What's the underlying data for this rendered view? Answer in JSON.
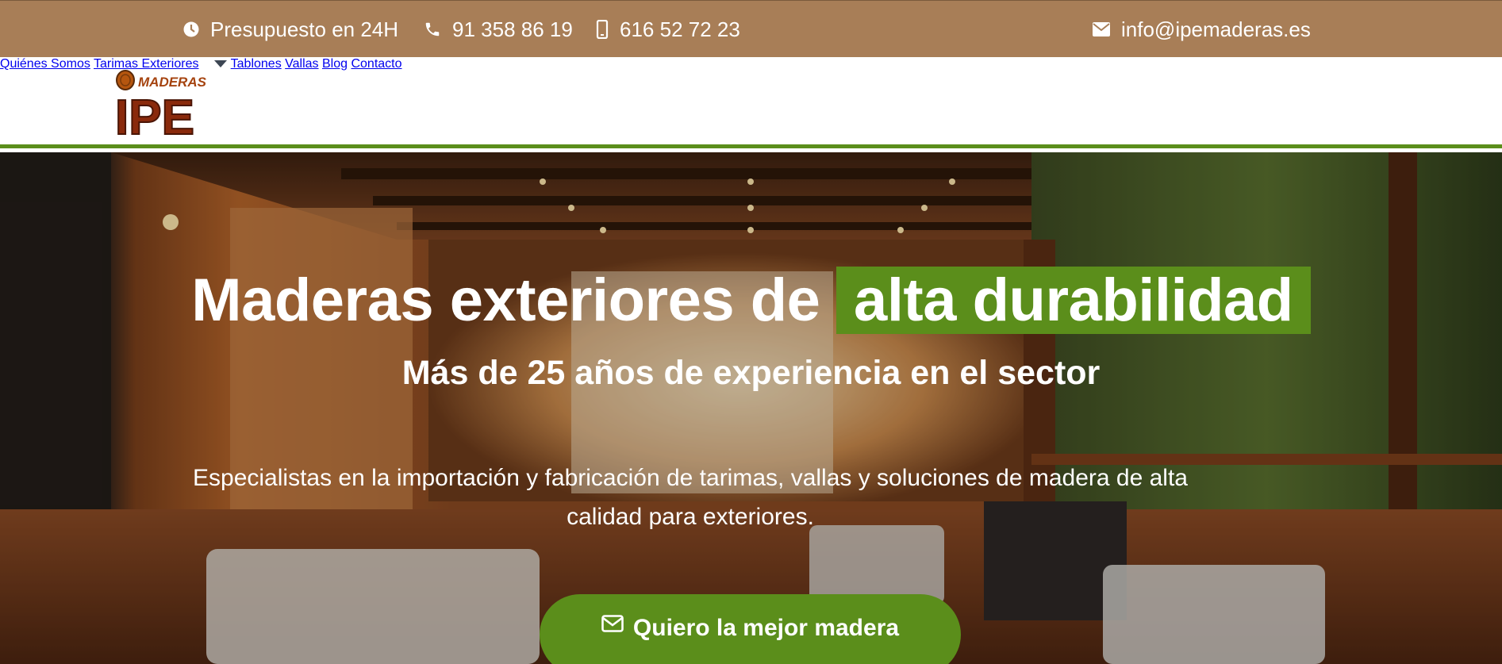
{
  "topbar": {
    "quote": "Presupuesto en 24H",
    "phone": "91 358 86 19",
    "mobile": "616 52 72 23",
    "email": "info@ipemaderas.es"
  },
  "logo": {
    "line1": "MADERAS",
    "line2": "IPE"
  },
  "nav": {
    "items": [
      "Quiénes Somos",
      "Tarimas Exteriores",
      "Tablones",
      "Vallas",
      "Blog",
      "Contacto"
    ]
  },
  "hero": {
    "title_prefix": "Maderas exteriores de",
    "title_highlight": "alta durabilidad",
    "subtitle": "Más de 25 años de experiencia en el sector",
    "description": "Especialistas en la importación y fabricación de tarimas, vallas y soluciones de madera de alta calidad para exteriores.",
    "cta": "Quiero la mejor madera"
  },
  "colors": {
    "topbar": "#a87e57",
    "accent_green": "#5b8e1b",
    "nav_text": "#3d4653"
  },
  "icons": [
    "clock-icon",
    "phone-icon",
    "mobile-icon",
    "envelope-icon",
    "chevron-down-icon",
    "envelope-outline-icon"
  ]
}
